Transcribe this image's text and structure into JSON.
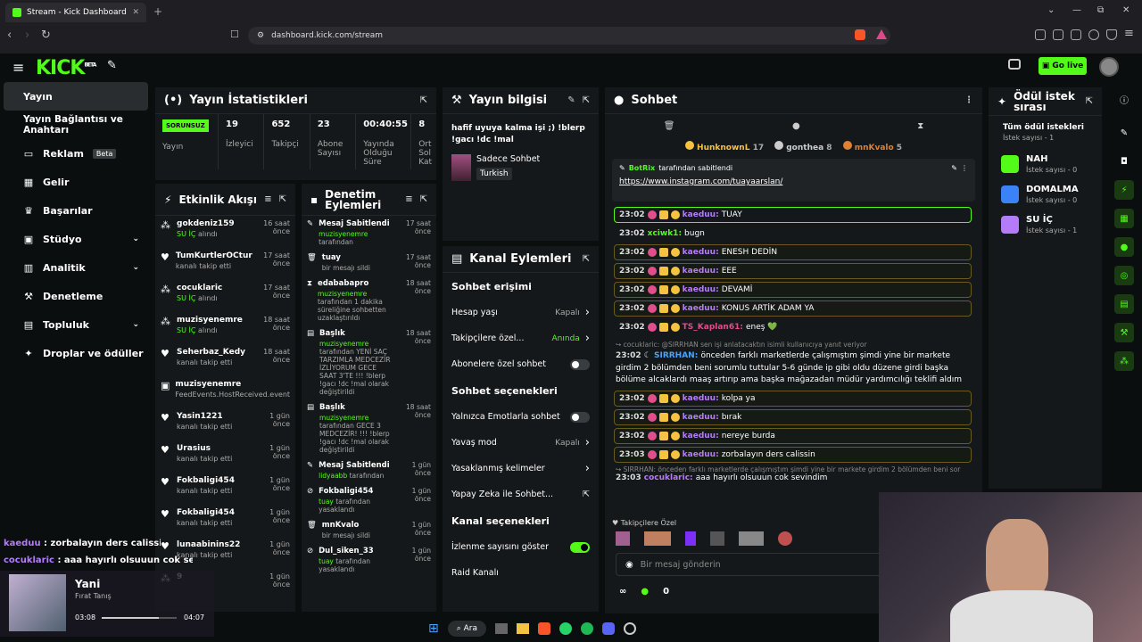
{
  "browser": {
    "tab_title": "Stream - Kick Dashboard",
    "url": "dashboard.kick.com/stream",
    "new_tab": "+",
    "window": [
      "⌄",
      "—",
      "⧉",
      "✕"
    ]
  },
  "header": {
    "logo": "KICK",
    "logo_sup": "BETA",
    "golive": "Go live"
  },
  "sidebar": {
    "items": [
      {
        "label": "Yayın"
      },
      {
        "label": "Yayın Bağlantısı ve Anahtarı"
      },
      {
        "label": "Reklam",
        "badge": "Beta"
      },
      {
        "label": "Gelir"
      },
      {
        "label": "Başarılar"
      },
      {
        "label": "Stüdyo"
      },
      {
        "label": "Analitik"
      },
      {
        "label": "Denetleme"
      },
      {
        "label": "Topluluk"
      },
      {
        "label": "Droplar ve ödüller"
      }
    ]
  },
  "stats": {
    "title": "Yayın İstatistikleri",
    "status": "SORUNSUZ",
    "status_label": "Yayın",
    "viewers": "19",
    "viewers_label": "İzleyici",
    "followers": "652",
    "followers_label": "Takipçi",
    "subs": "23",
    "subs_label": "Abone Sayısı",
    "duration": "00:40:55",
    "duration_label": "Yayında Olduğu Süre",
    "extra": "8",
    "extra_label": "Ort Sol Kat"
  },
  "activity": {
    "title": "Etkinlik Akışı",
    "items": [
      {
        "name": "gokdeniz159",
        "sub": "SU İÇ",
        "sub2": " alındı",
        "time": "16 saat önce"
      },
      {
        "name": "TumKurtlerOCtur",
        "sub": "kanalı takip etti",
        "sub2": "",
        "time": "17 saat önce"
      },
      {
        "name": "cocuklaric",
        "sub": "SU İÇ",
        "sub2": " alındı",
        "time": "17 saat önce"
      },
      {
        "name": "muzisyenemre",
        "sub": "SU İÇ",
        "sub2": " alındı",
        "time": "18 saat önce"
      },
      {
        "name": "Seherbaz_Kedy",
        "sub": "kanalı takip etti",
        "sub2": "",
        "time": "18 saat önce"
      },
      {
        "name": "muzisyenemre",
        "sub": "FeedEvents.HostReceived.event",
        "sub2": "",
        "time": "18 saat önce"
      },
      {
        "name": "Yasin1221",
        "sub": "kanalı takip etti",
        "sub2": "",
        "time": "1 gün önce"
      },
      {
        "name": "Urasius",
        "sub": "kanalı takip etti",
        "sub2": "",
        "time": "1 gün önce"
      },
      {
        "name": "Fokbaligi454",
        "sub": "kanalı takip etti",
        "sub2": "",
        "time": "1 gün önce"
      },
      {
        "name": "Fokbaligi454",
        "sub": "kanalı takip etti",
        "sub2": "",
        "time": "1 gün önce"
      },
      {
        "name": "lunaabinins22",
        "sub": "kanalı takip etti",
        "sub2": "",
        "time": "1 gün önce"
      },
      {
        "name": "9",
        "sub": "",
        "sub2": "",
        "time": "1 gün önce"
      }
    ]
  },
  "moderation": {
    "title": "Denetim Eylemleri",
    "items": [
      {
        "title": "Mesaj Sabitlendi",
        "user": "muzisyenemre",
        "rest": " tarafından",
        "time": "17 saat önce"
      },
      {
        "title": "tuay",
        "user": "",
        "rest": "bir mesajı sildi",
        "time": "17 saat önce"
      },
      {
        "title": "edababapro",
        "user": "muzisyenemre",
        "rest": " tarafından 1 dakika süreliğine sohbetten uzaklaştırıldı",
        "time": "18 saat önce"
      },
      {
        "title": "Başlık",
        "user": "muzisyenemre",
        "rest": " tarafından YENİ SAÇ TARZIMLA MEDCEZİR İZLİYORUM GECE SAAT 3'TE !!! !blerp !gacı !dc !mal olarak değiştirildi",
        "time": "18 saat önce"
      },
      {
        "title": "Başlık",
        "user": "muzisyenemre",
        "rest": " tarafından GECE 3 MEDCEZİR! !!! !blerp !gacı !dc !mal olarak değiştirildi",
        "time": "18 saat önce"
      },
      {
        "title": "Mesaj Sabitlendi",
        "user": "lidyaabb",
        "rest": " tarafından",
        "time": "1 gün önce"
      },
      {
        "title": "Fokbaligi454",
        "user": "tuay",
        "rest": " tarafından yasaklandı",
        "time": "1 gün önce"
      },
      {
        "title": "mnKvalo",
        "user": "",
        "rest": "bir mesajı sildi",
        "time": "1 gün önce"
      },
      {
        "title": "Dul_siken_33",
        "user": "tuay",
        "rest": " tarafından yasaklandı",
        "time": "1 gün önce"
      }
    ]
  },
  "info": {
    "title": "Yayın bilgisi",
    "stream_title": "hafif uyuya kalma işi ;) !blerp !gacı !dc !mal",
    "category": "Sadece Sohbet",
    "language": "Turkish"
  },
  "channel": {
    "title": "Kanal Eylemleri",
    "s1": "Sohbet erişimi",
    "rows1": [
      {
        "label": "Hesap yaşı",
        "value": "Kapalı",
        "kind": "chev"
      },
      {
        "label": "Takipçilere özel...",
        "value": "Anında",
        "kind": "chev"
      },
      {
        "label": "Abonelere özel sohbet",
        "value": "",
        "kind": "toggle"
      }
    ],
    "s2": "Sohbet seçenekleri",
    "rows2": [
      {
        "label": "Yalnızca Emotlarla sohbet",
        "value": "",
        "kind": "toggle"
      },
      {
        "label": "Yavaş mod",
        "value": "Kapalı",
        "kind": "chev"
      },
      {
        "label": "Yasaklanmış kelimeler",
        "value": "",
        "kind": "chev"
      },
      {
        "label": "Yapay Zeka ile Sohbet...",
        "value": "",
        "kind": "ext"
      }
    ],
    "s3": "Kanal seçenekleri",
    "rows3": [
      {
        "label": "İzlenme sayısını göster",
        "value": "",
        "kind": "toggle-on"
      },
      {
        "label": "Raid Kanalı",
        "value": "",
        "kind": ""
      }
    ]
  },
  "chat": {
    "title": "Sohbet",
    "leaders": [
      {
        "name": "HunknownL",
        "n": "17"
      },
      {
        "name": "gonthea",
        "n": "8"
      },
      {
        "name": "mnKvalo",
        "n": "5"
      }
    ],
    "pinned_by": "BotRix",
    "pinned_suffix": " tarafından sabitlendi",
    "pinned_link": "https://www.instagram.com/tuayaarslan/",
    "messages": [
      {
        "t": "23:02",
        "u": "kaeduu",
        "c": "u-pk",
        "m": "TUAY",
        "hl": "hlg"
      },
      {
        "t": "23:02",
        "u": "xciwk1",
        "c": "u-gr",
        "m": "bugn",
        "hl": ""
      },
      {
        "t": "23:02",
        "u": "kaeduu",
        "c": "u-pk",
        "m": "ENESH DEDİN",
        "hl": "hl"
      },
      {
        "t": "23:02",
        "u": "kaeduu",
        "c": "u-pk",
        "m": "EEE",
        "hl": "hl"
      },
      {
        "t": "23:02",
        "u": "kaeduu",
        "c": "u-pk",
        "m": "DEVAMİ",
        "hl": "hl"
      },
      {
        "t": "23:02",
        "u": "kaeduu",
        "c": "u-pk",
        "m": "KONUS ARTİK ADAM YA",
        "hl": "hl"
      },
      {
        "t": "23:02",
        "u": "TS_Kaplan61",
        "c": "u-pi",
        "m": "eneş 💚",
        "hl": ""
      }
    ],
    "reply1": "cocuklaric: @SIRRHAN sen işi anlatacaktın isimli kullanıcıya yanıt veriyor",
    "long": {
      "t": "23:02",
      "u": "SIRRHAN",
      "m": "önceden farklı marketlerde çalışmıştım şimdi yine bir markete girdim 2 bölümden beni sorumlu tuttular 5-6 günde ip gibi oldu düzene girdi başka bölüme alcaklardı maaş artırıp ama başka mağazadan müdür yardımcılığı teklifi aldım"
    },
    "messages2": [
      {
        "t": "23:02",
        "u": "kaeduu",
        "c": "u-pk",
        "m": "kolpa ya",
        "hl": "hl"
      },
      {
        "t": "23:02",
        "u": "kaeduu",
        "c": "u-pk",
        "m": "bırak",
        "hl": "hl"
      },
      {
        "t": "23:02",
        "u": "kaeduu",
        "c": "u-pk",
        "m": "nereye burda",
        "hl": "hl"
      },
      {
        "t": "23:03",
        "u": "kaeduu",
        "c": "u-pk",
        "m": "zorbalayın ders calissin",
        "hl": "hl"
      }
    ],
    "reply2": "SIRRHAN: önceden farklı marketlerde çalışmıştım şimdi yine bir markete girdim 2 bölümden beni sor",
    "last": {
      "t": "23:03",
      "u": "cocuklaric",
      "m": "aaa hayırlı olsuuun cok sevindim"
    },
    "followers_only": "Takipçilere Özel",
    "input_placeholder": "Bir mesaj gönderin",
    "count": "0",
    "inf": "∞"
  },
  "rewards": {
    "title": "Ödül istek sırası",
    "all": "Tüm ödül istekleri",
    "count_label": "İstek sayısı - 1",
    "items": [
      {
        "name": "NAH",
        "sub": "İstek sayısı - 0",
        "color": "#53fc18"
      },
      {
        "name": "DOMALMA",
        "sub": "İstek sayısı - 0",
        "color": "#3b82f6"
      },
      {
        "name": "SU İÇ",
        "sub": "İstek sayısı - 1",
        "color": "#b57cf9"
      }
    ]
  },
  "overlay": {
    "m1_user": "kaeduu",
    "m1": " : zorbalayın ders calissin",
    "m2_user": "cocuklaric",
    "m2": " : aaa hayırlı olsuuun cok sevindim"
  },
  "player": {
    "title": "Yani",
    "artist": "Fırat Tanış",
    "elapsed": "03:08",
    "total": "04:07",
    "progress": 0.76
  },
  "taskbar": {
    "search": "Ara"
  }
}
